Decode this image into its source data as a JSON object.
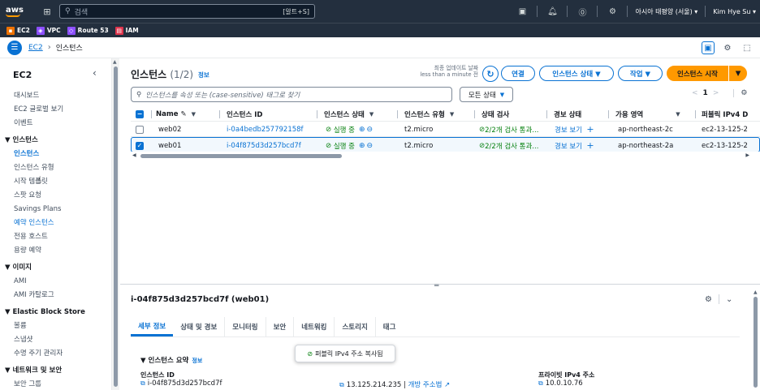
{
  "topnav": {
    "logo": "aws",
    "search_placeholder": "검색",
    "search_shortcut": "[알트+S]",
    "region": "아시아 태평양 (서울) ▾",
    "user": "Kim Hye Su ▾"
  },
  "favorites": [
    {
      "label": "EC2",
      "color": "#ed7100",
      "icon": "ec2-icon"
    },
    {
      "label": "VPC",
      "color": "#8c4fff",
      "icon": "vpc-icon"
    },
    {
      "label": "Route 53",
      "color": "#8c4fff",
      "icon": "route53-icon"
    },
    {
      "label": "IAM",
      "color": "#dd344c",
      "icon": "iam-icon"
    }
  ],
  "breadcrumb": {
    "root": "EC2",
    "current": "인스턴스"
  },
  "sidebar": {
    "title": "EC2",
    "items": [
      {
        "label": "대시보드",
        "type": "item"
      },
      {
        "label": "EC2 글로벌 보기",
        "type": "item"
      },
      {
        "label": "이벤트",
        "type": "item"
      },
      {
        "label": "▼ 인스턴스",
        "type": "section"
      },
      {
        "label": "인스턴스",
        "type": "active"
      },
      {
        "label": "인스턴스 유형",
        "type": "item"
      },
      {
        "label": "시작 템플릿",
        "type": "item"
      },
      {
        "label": "스팟 요청",
        "type": "item"
      },
      {
        "label": "Savings Plans",
        "type": "item"
      },
      {
        "label": "예약 인스턴스",
        "type": "link"
      },
      {
        "label": "전용 호스트",
        "type": "item"
      },
      {
        "label": "용량 예약",
        "type": "item"
      },
      {
        "label": "▼ 이미지",
        "type": "section"
      },
      {
        "label": "AMI",
        "type": "item"
      },
      {
        "label": "AMI 카탈로그",
        "type": "item"
      },
      {
        "label": "▼ Elastic Block Store",
        "type": "section"
      },
      {
        "label": "볼륨",
        "type": "item"
      },
      {
        "label": "스냅샷",
        "type": "item"
      },
      {
        "label": "수명 주기 관리자",
        "type": "item"
      },
      {
        "label": "▼ 네트워크 및 보안",
        "type": "section"
      },
      {
        "label": "보안 그룹",
        "type": "item"
      }
    ]
  },
  "instances_header": {
    "title": "인스턴스",
    "count": "(1/2)",
    "info": "정보",
    "last_updated_1": "최종 업데이트 날짜",
    "last_updated_2": "less than a minute 전",
    "connect": "연결",
    "state": "인스턴스 상태 ▼",
    "actions": "작업 ▼",
    "launch": "인스턴스 시작",
    "launch_dd": "▼"
  },
  "filter": {
    "placeholder": "인스턴스를 속성 또는 (case-sensitive) 태그로 찾기",
    "state_filter": "모든 상태"
  },
  "pagination": {
    "prev": "<",
    "page": "1",
    "next": ">"
  },
  "table": {
    "columns": [
      "Name",
      "인스턴스 ID",
      "인스턴스 상태",
      "인스턴스 유형",
      "상태 검사",
      "경보 상태",
      "가용 영역",
      "퍼블릭 IPv4 D"
    ],
    "rows": [
      {
        "selected": false,
        "name": "web02",
        "id": "i-0a4bedb257792158f",
        "state": "실행 중",
        "type": "t2.micro",
        "check": "2/2개 검사 통과...",
        "alarm": "경보 보기",
        "az": "ap-northeast-2c",
        "dns": "ec2-13-125-2"
      },
      {
        "selected": true,
        "name": "web01",
        "id": "i-04f875d3d257bcd7f",
        "state": "실행 중",
        "type": "t2.micro",
        "check": "2/2개 검사 통과...",
        "alarm": "경보 보기",
        "az": "ap-northeast-2a",
        "dns": "ec2-13-125-2"
      }
    ]
  },
  "detail": {
    "title": "i-04f875d3d257bcd7f (web01)",
    "tabs": [
      "세부 정보",
      "상태 및 경보",
      "모니터링",
      "보안",
      "네트워킹",
      "스토리지",
      "태그"
    ],
    "summary_title": "▼ 인스턴스 요약",
    "summary_info": "정보",
    "instance_id_label": "인스턴스 ID",
    "instance_id": "i-04f875d3d257bcd7f",
    "public_ip": "13.125.214.235",
    "open_address": "개방 주소법",
    "private_ip_label": "프라이빗 IPv4 주소",
    "private_ip": "10.0.10.76",
    "toast": "퍼블릭 IPv4 주소 복사됨"
  },
  "colors": {
    "accent": "#0972d3",
    "nav": "#232f3e",
    "primary": "#ff9900",
    "success": "#037f0c"
  }
}
